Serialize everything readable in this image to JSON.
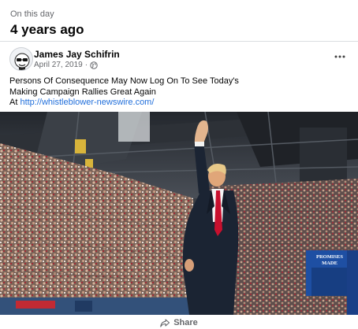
{
  "memory": {
    "label": "On this day",
    "title": "4 years ago"
  },
  "post": {
    "author": "James Jay Schifrin",
    "date": "April 27, 2019",
    "separator": "·",
    "privacy_icon": "globe-icon",
    "more_icon": "more-options-icon",
    "text_line1": "Persons Of Consequence May Now Log On To See Today's",
    "text_line2": "Making Campaign Rallies Great Again",
    "text_prefix": "At ",
    "link": "http://whistleblower-newswire.com/",
    "photo": {
      "sign_line1": "PROMISES",
      "sign_line2": "MADE"
    }
  },
  "actions": {
    "share_label": "Share",
    "share_icon": "share-arrow-icon"
  },
  "colors": {
    "link": "#216fdb",
    "secondary_text": "#65676b",
    "divider": "#dadde1",
    "suit": "#1b2433",
    "tie": "#c8102e",
    "sign_blue": "#1e4fa3"
  }
}
